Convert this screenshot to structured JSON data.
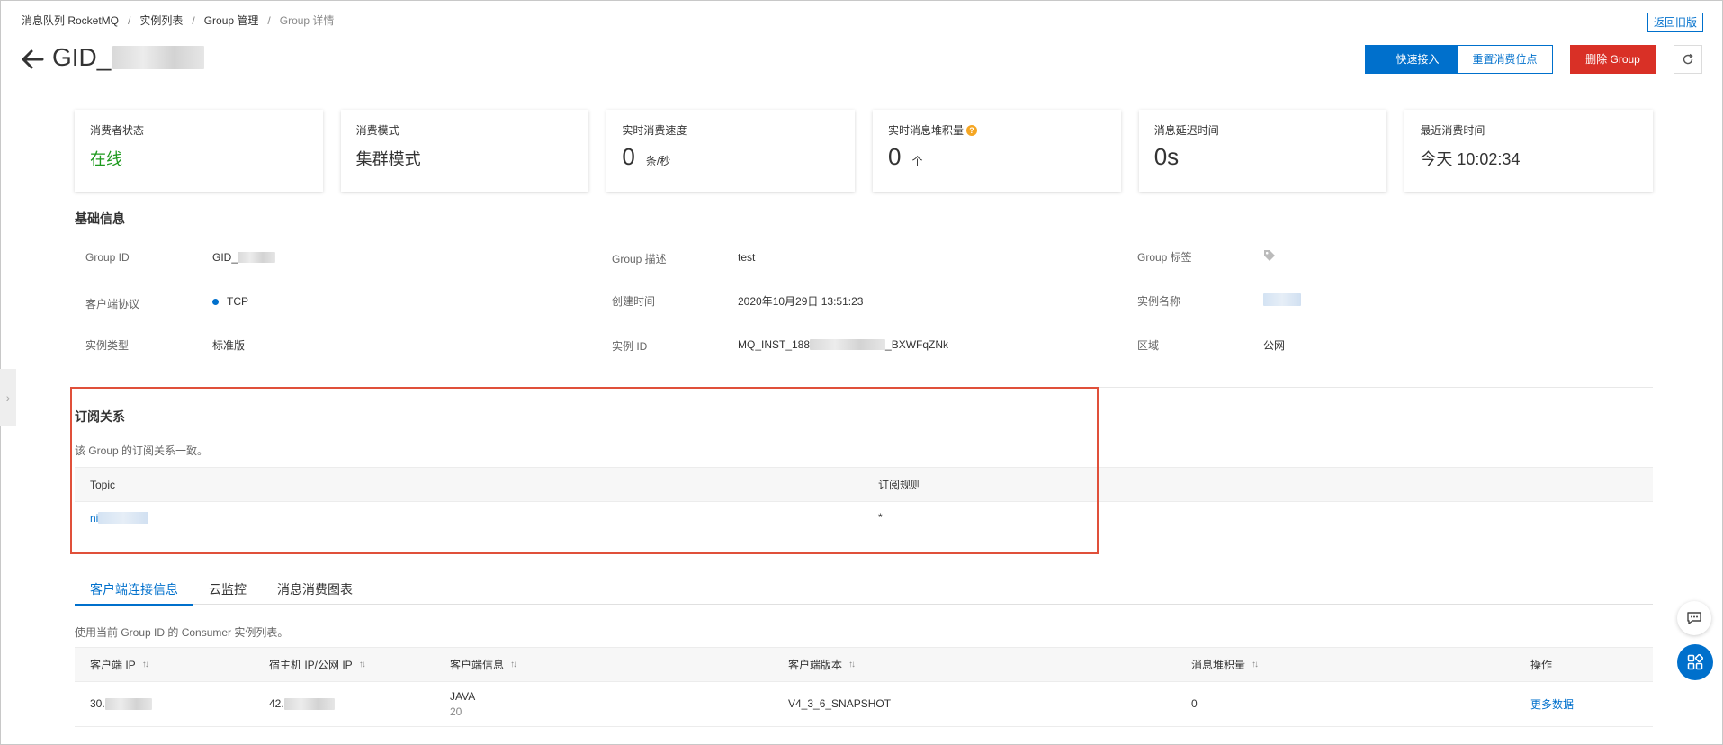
{
  "breadcrumb": {
    "items": [
      "消息队列 RocketMQ",
      "实例列表",
      "Group 管理"
    ],
    "current": "Group 详情",
    "separator": "/"
  },
  "header": {
    "old_version": "返回旧版",
    "title_prefix": "GID_",
    "buttons": {
      "quick_access": "快速接入",
      "reset_offset": "重置消费位点",
      "delete_group": "删除 Group"
    }
  },
  "metrics": {
    "consumer_status": {
      "label": "消费者状态",
      "value": "在线"
    },
    "consume_mode": {
      "label": "消费模式",
      "value": "集群模式"
    },
    "realtime_speed": {
      "label": "实时消费速度",
      "value": "0",
      "unit": "条/秒"
    },
    "backlog": {
      "label": "实时消息堆积量",
      "value": "0",
      "unit": "个",
      "help": "?"
    },
    "delay": {
      "label": "消息延迟时间",
      "value": "0s"
    },
    "last_consume": {
      "label": "最近消费时间",
      "value": "今天 10:02:34"
    }
  },
  "basic_info": {
    "title": "基础信息",
    "group_id": {
      "label": "Group ID",
      "value": "GID_"
    },
    "group_desc": {
      "label": "Group 描述",
      "value": "test"
    },
    "group_tag": {
      "label": "Group 标签"
    },
    "protocol": {
      "label": "客户端协议",
      "value": "TCP"
    },
    "created": {
      "label": "创建时间",
      "value": "2020年10月29日 13:51:23"
    },
    "instance_name": {
      "label": "实例名称"
    },
    "instance_type": {
      "label": "实例类型",
      "value": "标准版"
    },
    "instance_id": {
      "label": "实例 ID",
      "value_prefix": "MQ_INST_188",
      "value_suffix": "_BXWFqZNk"
    },
    "region": {
      "label": "区域",
      "value": "公网"
    }
  },
  "subscription": {
    "title": "订阅关系",
    "note": "该 Group 的订阅关系一致。",
    "columns": [
      "Topic",
      "订阅规则"
    ],
    "rows": [
      {
        "topic": "ni",
        "rule": "*"
      }
    ]
  },
  "tabs": {
    "items": [
      "客户端连接信息",
      "云监控",
      "消息消费图表"
    ],
    "active": 0
  },
  "clients": {
    "note": "使用当前 Group ID 的 Consumer 实例列表。",
    "columns": [
      "客户端 IP",
      "宿主机 IP/公网 IP",
      "客户端信息",
      "客户端版本",
      "消息堆积量",
      "操作"
    ],
    "rows": [
      {
        "client_ip": "30.",
        "host_ip": "42.",
        "client_info": "JAVA",
        "client_info_sub": "20",
        "version": "V4_3_6_SNAPSHOT",
        "backlog": "0",
        "action": "更多数据"
      }
    ]
  },
  "icons": {
    "back": "arrow-left-icon",
    "refresh": "refresh-icon",
    "tag": "tag-icon",
    "chat": "chat-icon",
    "apps": "apps-icon",
    "sort": "sort-icon"
  },
  "colors": {
    "primary": "#0070cc",
    "danger": "#d93026",
    "online": "#1e9a1e",
    "highlight": "#e0503a"
  }
}
